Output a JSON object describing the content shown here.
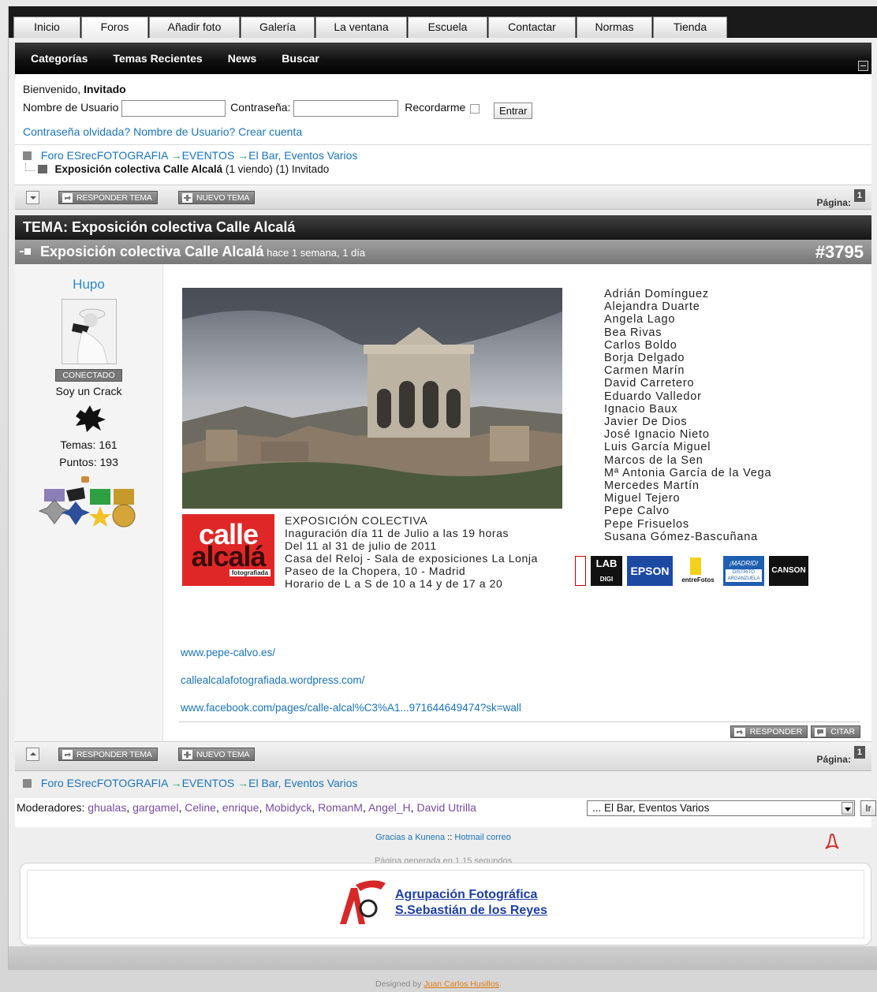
{
  "tabs": [
    "Inicio",
    "Foros",
    "Añadir foto",
    "Galería",
    "La ventana",
    "Escuela",
    "Contactar",
    "Normas",
    "Tienda"
  ],
  "active_tab": "Foros",
  "catbar": [
    "Categorías",
    "Temas Recientes",
    "News",
    "Buscar"
  ],
  "login": {
    "welcome": "Bienvenido,",
    "guest": "Invitado",
    "user_label": "Nombre de Usuario",
    "pass_label": "Contraseña:",
    "remember_label": "Recordarme",
    "submit": "Entrar",
    "forgot_pass": "Contraseña olvidada?",
    "forgot_user": "Nombre de Usuario?",
    "create": "Crear cuenta"
  },
  "breadcrumb": {
    "root": "Foro ESrecFOTOGRAFIA",
    "cat": "EVENTOS",
    "sub": "El Bar, Eventos Varios",
    "topic": "Exposición colectiva Calle Alcalá",
    "viewers": "(1 viendo) (1) Invitado"
  },
  "toolbar": {
    "reply_topic": "RESPONDER TEMA",
    "new_topic": "NUEVO TEMA",
    "page_label": "Página:",
    "page_num": "1"
  },
  "topic_header": "TEMA: Exposición colectiva Calle Alcalá",
  "post": {
    "title": "Exposición colectiva Calle Alcalá",
    "time": "hace 1 semana, 1 día",
    "number": "#3795",
    "author": "Hupo",
    "status": "CONECTADO",
    "rank": "Soy un Crack",
    "temas": "Temas: 161",
    "puntos": "Puntos: 193",
    "reply": "RESPONDER",
    "quote": "CITAR"
  },
  "flyer": {
    "names": [
      "Adrián Domínguez",
      "Alejandra Duarte",
      "Angela Lago",
      "Bea Rivas",
      "Carlos Boldo",
      "Borja Delgado",
      "Carmen Marín",
      "David Carretero",
      "Eduardo Valledor",
      "Ignacio Baux",
      "Javier De Dios",
      "José Ignacio Nieto",
      "Luis García Miguel",
      "Marcos de la Sen",
      "Mª Antonia García de la Vega",
      "Mercedes Martín",
      "Miguel Tejero",
      "Pepe Calvo",
      "Pepe Frisuelos",
      "Susana Gómez-Bascuñana"
    ],
    "logo_line1": "calle",
    "logo_line2": "alcalá",
    "logo_sub": "fotografiada",
    "expo_lines": [
      "EXPOSICIÓN COLECTIVA",
      "Inaguración día 11 de Julio a las 19 horas",
      "Del 11 al 31 de julio de 2011",
      "Casa del Reloj - Sala de exposiciones La Lonja",
      "Paseo de la Chopera, 10 - Madrid",
      "Horario de L a S de 10 a 14 y de 17 a 20"
    ],
    "sponsors": {
      "lab": "LAB",
      "digi": "DIGI",
      "epson": "EPSON",
      "entre": "entreFotos",
      "madrid": "¡MADRID!",
      "distrito": "DISTRITO ARGANZUELA",
      "canson": "CANSON"
    }
  },
  "links": [
    "www.pepe-calvo.es/",
    "callealcalafotografiada.wordpress.com/",
    "www.facebook.com/pages/calle-alcal%C3%A1...971644649474?sk=wall"
  ],
  "moderators_label": "Moderadores:",
  "moderators": [
    "ghualas",
    "gargamel",
    "Celine",
    "enrique",
    "Mobidyck",
    "RomanM",
    "Angel_H",
    "David Utrilla"
  ],
  "jump_select": "... El Bar, Eventos Varios",
  "jump_button": "Ir",
  "footer": {
    "thanks": "Gracias a Kunena",
    "sep": "::",
    "hotmail": "Hotmail correo",
    "generated": "Página generada en 1.15 segundos"
  },
  "banner": {
    "line1": "Agrupación Fotográfica",
    "line2": "S.Sebastián de los Reyes"
  },
  "designed_by": "Designed by",
  "designer": "Juan Carlos Husillos",
  "colors": {
    "link": "#1b74b8",
    "moderator": "#7a4aa0",
    "calle_red": "#e02727",
    "epson_blue": "#1c4aa3"
  }
}
